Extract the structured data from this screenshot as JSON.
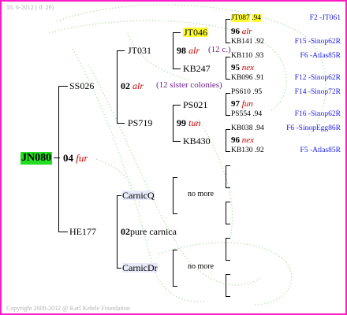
{
  "header": {
    "date": "18. 6-2012 ( 0: 29)"
  },
  "root": {
    "id": "JN080",
    "year": "04",
    "origin": "fur"
  },
  "gen1": [
    {
      "id": "SS026",
      "year": "02",
      "origin": "alr",
      "note": "(12 sister colonies)"
    },
    {
      "id": "HE177",
      "year": "02",
      "origin": "pure carnica"
    }
  ],
  "gen2": [
    {
      "id": "JT031",
      "year": "98",
      "origin": "alr",
      "note": "(12 c.)"
    },
    {
      "id": "PS719",
      "year": "99",
      "origin": "tun"
    },
    {
      "id": "CarnicQ",
      "status": "no more"
    },
    {
      "id": "CarnicDr",
      "status": "no more"
    }
  ],
  "gen3": [
    {
      "id": "JT046",
      "year": "96",
      "origin": "alr"
    },
    {
      "id": "KB247",
      "year": "95",
      "origin": "nex"
    },
    {
      "id": "PS021",
      "year": "97",
      "origin": "fun"
    },
    {
      "id": "KB430",
      "year": "96",
      "origin": "nex"
    }
  ],
  "gen4": [
    {
      "id": "JT087",
      "year": ".94",
      "desc": "F2 -JT061"
    },
    {
      "id": "KB141",
      "year": ".92",
      "desc": "F15 -Sinop62R"
    },
    {
      "id": "KB110",
      "year": ".93",
      "desc": "F6 -Atlas85R"
    },
    {
      "id": "KB096",
      "year": ".91",
      "desc": "F12 -Sinop62R"
    },
    {
      "id": "PS610",
      "year": ".95",
      "desc": "F14 -Sinop72R"
    },
    {
      "id": "PS554",
      "year": ".94",
      "desc": "F16 -Sinop62R"
    },
    {
      "id": "KB038",
      "year": ".94",
      "desc": "F6 -SinopEgg86R"
    },
    {
      "id": "KB130",
      "year": ".92",
      "desc": "F5 -Atlas85R"
    }
  ],
  "colors": {
    "border": "#ff1cc6",
    "root_highlight": "#22dd22",
    "highlight": "#ffff33",
    "origin": "#cc0000",
    "descriptor": "#1a1ae6"
  },
  "footer": {
    "copyright": "Copyright 2008-2012 @ Karl Kehrle Foundation"
  }
}
